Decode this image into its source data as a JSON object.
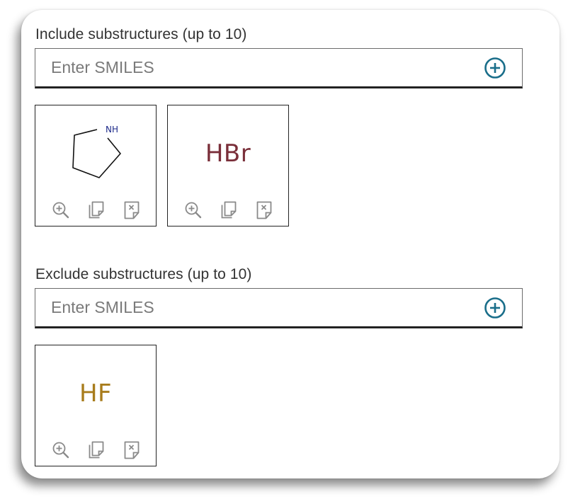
{
  "include": {
    "label": "Include substructures (up to 10)",
    "input_placeholder": "Enter SMILES",
    "add_icon": "circle-plus-icon",
    "tiles": [
      {
        "kind": "structure",
        "atom_label": "NH",
        "structure_name": "pyrrolidine"
      },
      {
        "kind": "formula",
        "formula": "HBr",
        "color": "#7a2f3a"
      }
    ]
  },
  "exclude": {
    "label": "Exclude substructures (up to 10)",
    "input_placeholder": "Enter SMILES",
    "add_icon": "circle-plus-icon",
    "tiles": [
      {
        "kind": "formula",
        "formula": "HF",
        "color": "#a87c1c"
      }
    ]
  },
  "tile_tools": [
    "zoom-in-icon",
    "copy-icon",
    "remove-icon"
  ],
  "colors": {
    "accent": "#1a6e8a",
    "border": "#222222",
    "icon_gray": "#8a8a8a",
    "bond": "#111111",
    "nitrogen": "#1d2a8a"
  }
}
